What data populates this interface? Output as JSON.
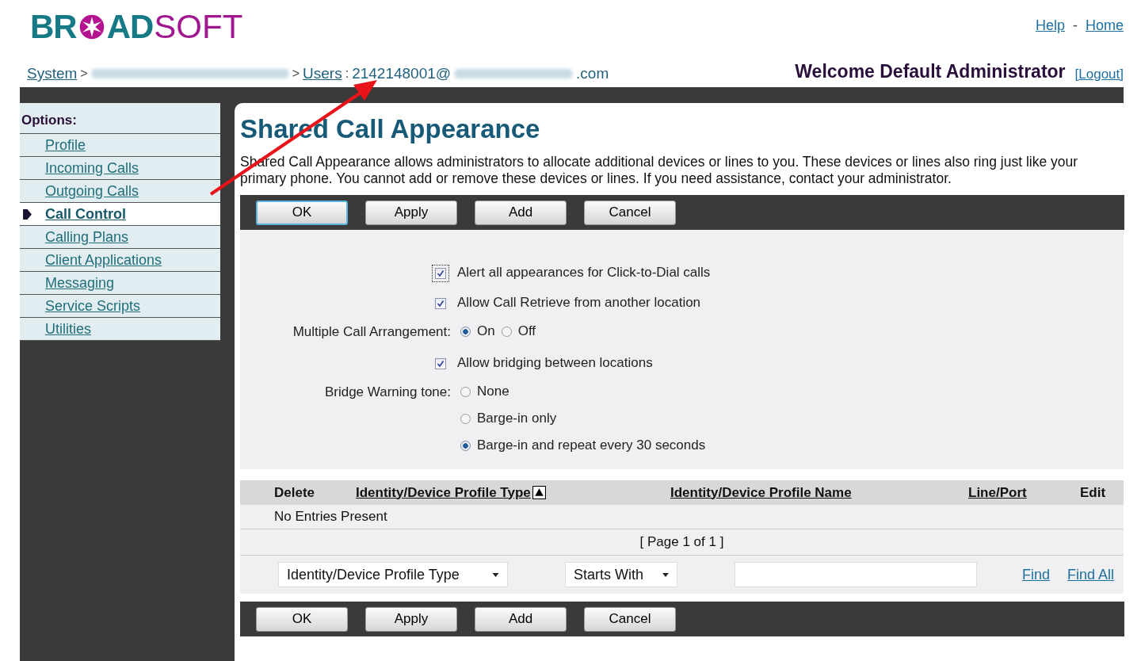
{
  "header": {
    "logo": {
      "part_1": "BR",
      "part_2": "AD",
      "part_3": "SOFT"
    },
    "links": [
      "Help",
      "Home"
    ],
    "link_separator": "-"
  },
  "breadcrumb": {
    "system": "System",
    "separator_1": ">",
    "separator_2": ">",
    "users": "Users",
    "colon": ":",
    "user_id_start": "2142148001@",
    "user_id_end": ".com"
  },
  "welcome": "Welcome Default Administrator",
  "logout": "[Logout]",
  "sidebar": {
    "heading": "Options:",
    "items": [
      {
        "label": "Profile",
        "selected": false
      },
      {
        "label": "Incoming Calls",
        "selected": false
      },
      {
        "label": "Outgoing Calls",
        "selected": false
      },
      {
        "label": "Call Control",
        "selected": true
      },
      {
        "label": "Calling Plans",
        "selected": false
      },
      {
        "label": "Client Applications",
        "selected": false
      },
      {
        "label": "Messaging",
        "selected": false
      },
      {
        "label": "Service Scripts",
        "selected": false
      },
      {
        "label": "Utilities",
        "selected": false
      }
    ]
  },
  "page": {
    "title": "Shared Call Appearance",
    "description": "Shared Call Appearance allows administrators to allocate additional devices or lines to you. These devices or lines also ring just like your primary phone. You cannot add or remove these devices or lines. If you need assistance, contact your administrator."
  },
  "top_buttons": [
    {
      "label": "OK",
      "focused": true
    },
    {
      "label": "Apply",
      "focused": false
    },
    {
      "label": "Add",
      "focused": false
    },
    {
      "label": "Cancel",
      "focused": false
    }
  ],
  "form_rows": [
    {
      "kind": "checkbox",
      "label": "Alert all appearances for Click-to-Dial calls",
      "checked": true,
      "focused": true
    },
    {
      "kind": "checkbox",
      "label": "Allow Call Retrieve from another location",
      "checked": true,
      "focused": false
    },
    {
      "kind": "radio_row",
      "label": "Multiple Call Arrangement:",
      "options": [
        {
          "label": "On",
          "selected": true
        },
        {
          "label": "Off",
          "selected": false
        }
      ]
    },
    {
      "kind": "checkbox",
      "label": "Allow bridging between locations",
      "checked": true,
      "focused": false
    },
    {
      "kind": "radio_list",
      "label": "Bridge Warning tone:",
      "options": [
        {
          "label": "None",
          "selected": false
        },
        {
          "label": "Barge-in only",
          "selected": false
        },
        {
          "label": "Barge-in and repeat every 30 seconds",
          "selected": true
        }
      ]
    }
  ],
  "table": {
    "columns": [
      {
        "label": "Delete",
        "sortable": false,
        "sorted": false
      },
      {
        "label": "Identity/Device Profile Type",
        "sortable": true,
        "sorted": true
      },
      {
        "label": "Identity/Device Profile Name",
        "sortable": true,
        "sorted": false
      },
      {
        "label": "Line/Port",
        "sortable": true,
        "sorted": false
      },
      {
        "label": "Edit",
        "sortable": false,
        "sorted": false
      }
    ],
    "empty_message": "No Entries Present",
    "pager": "[ Page 1 of 1 ]"
  },
  "search": {
    "column_select": "Identity/Device Profile Type",
    "mode_select": "Starts With",
    "links": [
      "Find",
      "Find All"
    ]
  },
  "bottom_buttons": [
    {
      "label": "OK",
      "focused": false
    },
    {
      "label": "Apply",
      "focused": false
    },
    {
      "label": "Add",
      "focused": false
    },
    {
      "label": "Cancel",
      "focused": false
    }
  ]
}
